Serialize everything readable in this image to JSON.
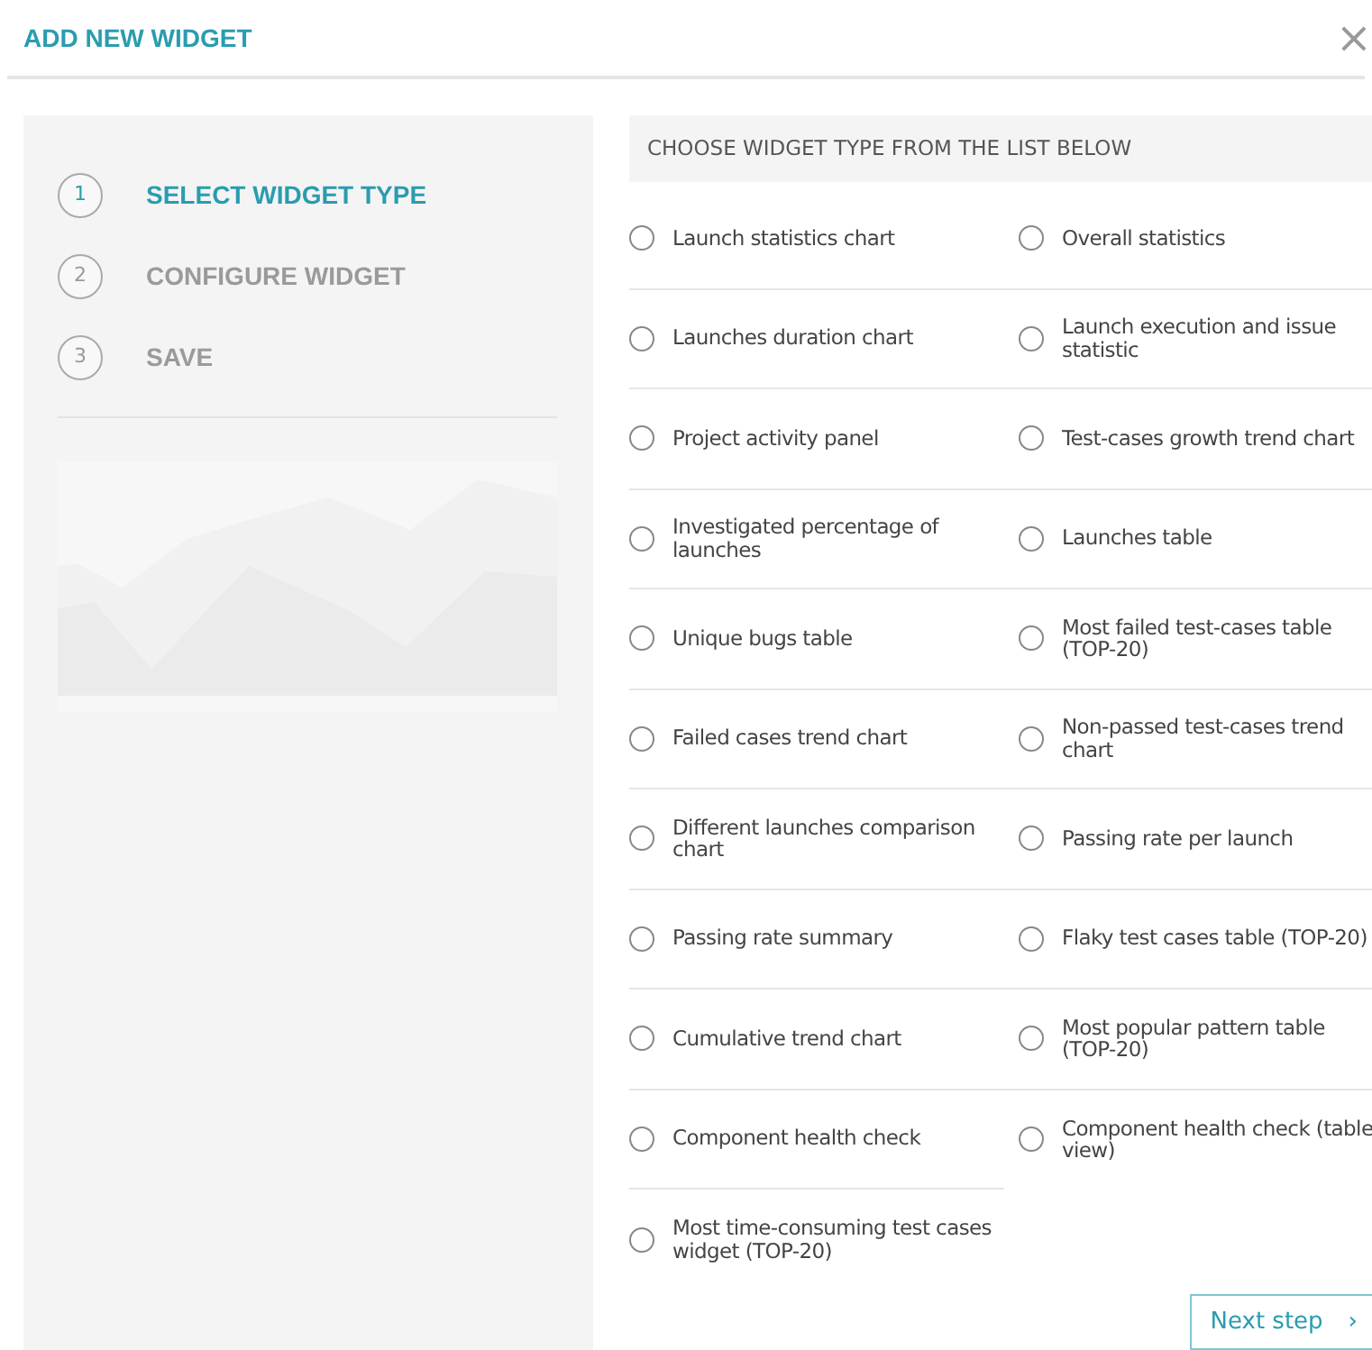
{
  "dialog": {
    "title": "ADD NEW WIDGET",
    "close": "×"
  },
  "steps": [
    {
      "number": "1",
      "label": "SELECT WIDGET TYPE",
      "selected": true
    },
    {
      "number": "2",
      "label": "CONFIGURE WIDGET",
      "selected": false
    },
    {
      "number": "3",
      "label": "SAVE",
      "selected": false
    }
  ],
  "list_header": "CHOOSE WIDGET TYPE FROM THE LIST BELOW",
  "widget_types": [
    {
      "label": "Launch statistics chart",
      "selected": false
    },
    {
      "label": "Overall statistics",
      "selected": false
    },
    {
      "label": "Launches duration chart",
      "selected": false
    },
    {
      "label": "Launch execution and issue statistic",
      "selected": false
    },
    {
      "label": "Project activity panel",
      "selected": false
    },
    {
      "label": "Test-cases growth trend chart",
      "selected": false
    },
    {
      "label": "Investigated percentage of launches",
      "selected": false
    },
    {
      "label": "Launches table",
      "selected": false
    },
    {
      "label": "Unique bugs table",
      "selected": false
    },
    {
      "label": "Most failed test-cases table (TOP-20)",
      "selected": false
    },
    {
      "label": "Failed cases trend chart",
      "selected": false
    },
    {
      "label": "Non-passed test-cases trend chart",
      "selected": false
    },
    {
      "label": "Different launches comparison chart",
      "selected": false
    },
    {
      "label": "Passing rate per launch",
      "selected": false
    },
    {
      "label": "Passing rate summary",
      "selected": false
    },
    {
      "label": "Flaky test cases table (TOP-20)",
      "selected": false
    },
    {
      "label": "Cumulative trend chart",
      "selected": false
    },
    {
      "label": "Most popular pattern table (TOP-20)",
      "selected": false
    },
    {
      "label": "Component health check",
      "selected": false
    },
    {
      "label": "Component health check (table view)",
      "selected": false
    },
    {
      "label": "Most time-consuming test cases widget (TOP-20)",
      "selected": false
    }
  ],
  "next_button": {
    "label": "Next step",
    "icon": "›"
  }
}
